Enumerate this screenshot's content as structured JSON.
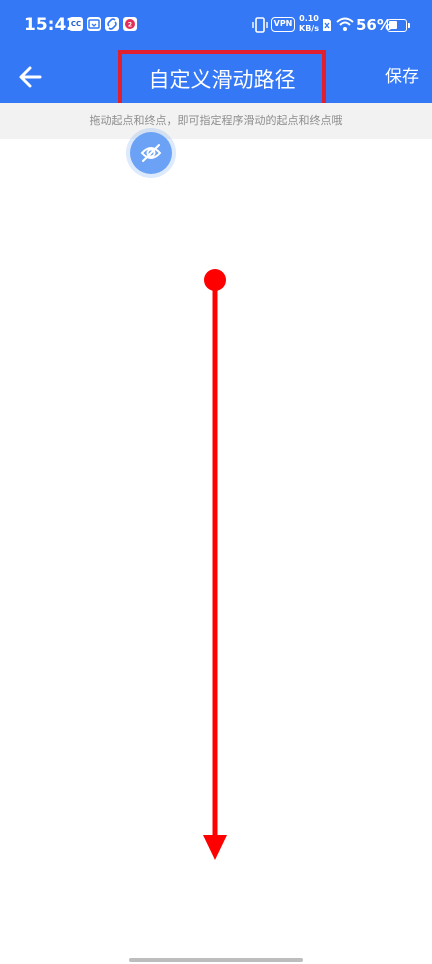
{
  "status_bar": {
    "time": "15:42",
    "notification_icons": [
      "cc-app-icon",
      "download-app-icon",
      "link-app-icon",
      "red-app-icon"
    ],
    "vpn_label": "VPN",
    "net_speed_value": "0.10",
    "net_speed_unit": "KB/s",
    "battery_percent": "56%",
    "battery_level": 0.56
  },
  "app_bar": {
    "title": "自定义滑动路径",
    "save_label": "保存",
    "back_icon": "arrow-left-icon"
  },
  "hint": {
    "text": "拖动起点和终点，即可指定程序滑动的起点和终点哦"
  },
  "float_button": {
    "icon": "eye-off-icon"
  },
  "path": {
    "start_marker": "start-point",
    "end_marker": "end-arrow",
    "direction": "down"
  },
  "colors": {
    "primary": "#3478f6",
    "path": "#ff0000",
    "highlight_box": "#e0202f",
    "hint_bg": "#f2f2f2",
    "float_button": "#6ba2f5"
  }
}
